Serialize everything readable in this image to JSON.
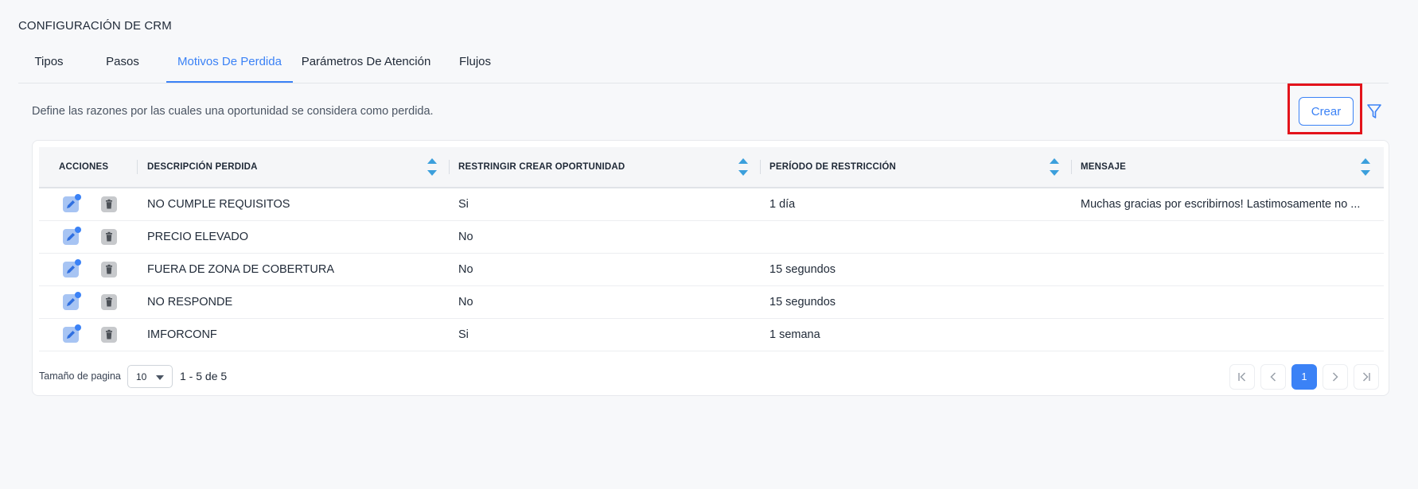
{
  "page": {
    "title": "CONFIGURACIÓN DE CRM",
    "description": "Define las razones por las cuales una oportunidad se considera como perdida."
  },
  "tabs": [
    {
      "label": "Tipos",
      "active": false
    },
    {
      "label": "Pasos",
      "active": false
    },
    {
      "label": "Motivos De Perdida",
      "active": true
    },
    {
      "label": "Parámetros De Atención",
      "active": false
    },
    {
      "label": "Flujos",
      "active": false
    }
  ],
  "toolbar": {
    "create_label": "Crear",
    "filter_icon": "filter-icon",
    "highlight_color": "#e3131b"
  },
  "table": {
    "columns": [
      {
        "label": "ACCIONES",
        "sortable": false
      },
      {
        "label": "DESCRIPCIÓN PERDIDA",
        "sortable": true
      },
      {
        "label": "RESTRINGIR CREAR OPORTUNIDAD",
        "sortable": true
      },
      {
        "label": "PERÍODO DE RESTRICCIÓN",
        "sortable": true
      },
      {
        "label": "MENSAJE",
        "sortable": true
      }
    ],
    "rows": [
      {
        "descripcion": "NO CUMPLE REQUISITOS",
        "restringir": "Si",
        "periodo": "1 día",
        "mensaje": "Muchas gracias por escribirnos! Lastimosamente no ..."
      },
      {
        "descripcion": "PRECIO ELEVADO",
        "restringir": "No",
        "periodo": "",
        "mensaje": ""
      },
      {
        "descripcion": "FUERA DE ZONA DE COBERTURA",
        "restringir": "No",
        "periodo": "15 segundos",
        "mensaje": ""
      },
      {
        "descripcion": "NO RESPONDE",
        "restringir": "No",
        "periodo": "15 segundos",
        "mensaje": ""
      },
      {
        "descripcion": "IMFORCONF",
        "restringir": "Si",
        "periodo": "1 semana",
        "mensaje": ""
      }
    ]
  },
  "pagination": {
    "page_size_label": "Tamaño de pagina",
    "page_size": "10",
    "range": "1 - 5 de 5",
    "current_page": "1",
    "accent_color": "#3b82f6"
  }
}
